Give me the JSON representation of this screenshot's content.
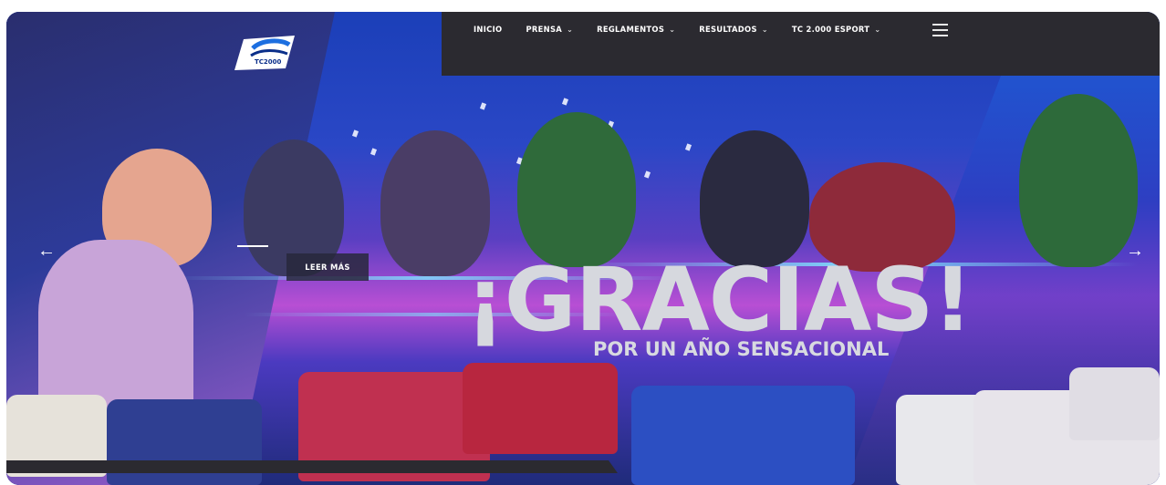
{
  "brand": {
    "logo_alt": "TC 2000",
    "logo_text": "TC2000"
  },
  "nav": {
    "items": [
      {
        "label": "INICIO",
        "has_dropdown": false
      },
      {
        "label": "PRENSA",
        "has_dropdown": true
      },
      {
        "label": "REGLAMENTOS",
        "has_dropdown": true
      },
      {
        "label": "RESULTADOS",
        "has_dropdown": true
      },
      {
        "label": "TC 2.000 ESPORT",
        "has_dropdown": true
      }
    ],
    "menu_icon": "hamburger-menu-icon",
    "dropdown_icon": "chevron-down-icon"
  },
  "hero": {
    "headline": "¡GRACIAS!",
    "subheadline": "POR UN AÑO SENSACIONAL",
    "cta_label": "LEER MÁS",
    "prev_icon": "arrow-left-icon",
    "next_icon": "arrow-right-icon"
  },
  "colors": {
    "nav_bg": "#2b2a30",
    "text_light": "#ffffff",
    "headline": "#d6d8de",
    "hero_blue": "#1b3fb8",
    "hero_magenta": "#b84fd4"
  }
}
